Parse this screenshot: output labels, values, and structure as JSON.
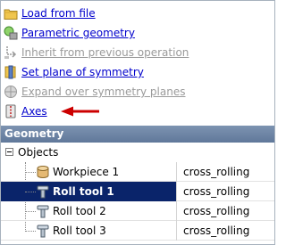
{
  "actions": [
    {
      "label": "Load from file",
      "icon": "folder-icon",
      "enabled": true
    },
    {
      "label": "Parametric geometry",
      "icon": "parametric-geometry-icon",
      "enabled": true
    },
    {
      "label": "Inherit from previous operation",
      "icon": "inherit-icon",
      "enabled": false
    },
    {
      "label": "Set plane of symmetry",
      "icon": "plane-of-symmetry-icon",
      "enabled": true
    },
    {
      "label": "Expand over symmetry planes",
      "icon": "expand-symmetry-icon",
      "enabled": false
    },
    {
      "label": "Axes",
      "icon": "axes-icon",
      "enabled": true
    }
  ],
  "panel": {
    "title": "Geometry"
  },
  "tree": {
    "root_label": "Objects",
    "items": [
      {
        "name": "Workpiece 1",
        "type": "cross_rolling",
        "icon": "workpiece-icon",
        "selected": false
      },
      {
        "name": "Roll tool 1",
        "type": "cross_rolling",
        "icon": "roll-tool-icon",
        "selected": true
      },
      {
        "name": "Roll tool 2",
        "type": "cross_rolling",
        "icon": "roll-tool-icon",
        "selected": false
      },
      {
        "name": "Roll tool 3",
        "type": "cross_rolling",
        "icon": "roll-tool-icon",
        "selected": false
      }
    ]
  },
  "colors": {
    "link": "#0000cc",
    "disabled": "#9a9a9a",
    "header": "#6a82a4",
    "selection": "#0a246a",
    "annotation_arrow": "#cc0000"
  }
}
